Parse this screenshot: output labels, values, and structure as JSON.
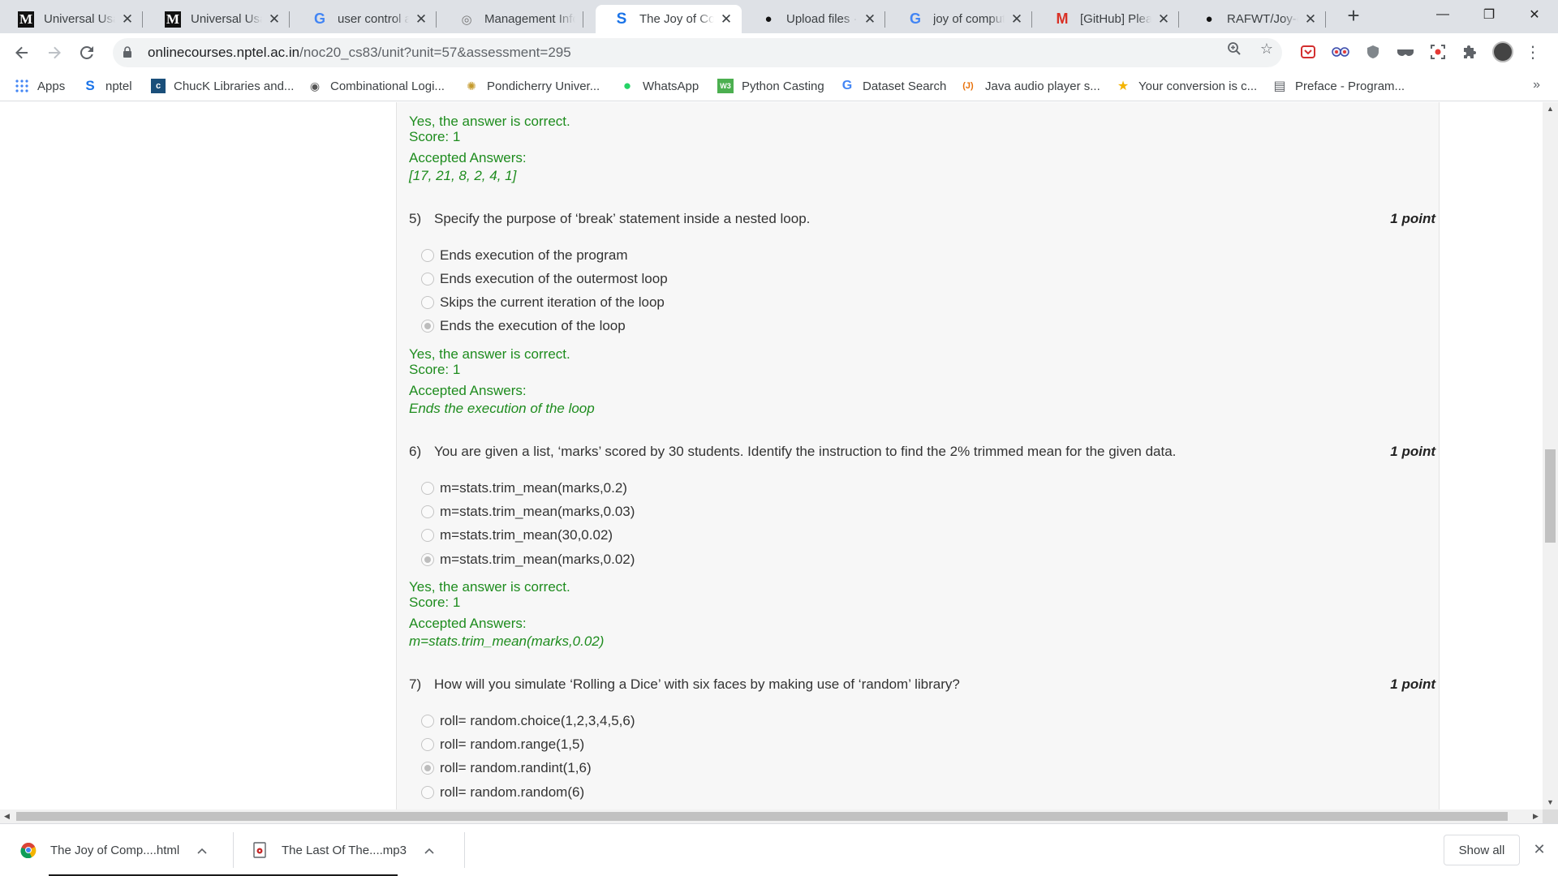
{
  "browser": {
    "tabs": [
      {
        "favicon": "medium-icon",
        "glyph": "M",
        "label": "Universal Usability in Practice",
        "active": false
      },
      {
        "favicon": "medium-icon",
        "glyph": "M",
        "label": "Universal Usability in Practice",
        "active": false
      },
      {
        "favicon": "google-icon",
        "glyph": "G",
        "label": "user control and freedom - Google Search",
        "active": false
      },
      {
        "favicon": "management-icon",
        "glyph": "◎",
        "label": "Management Information System",
        "active": false
      },
      {
        "favicon": "swayam-icon",
        "glyph": "S",
        "label": "The Joy of Computing using Python",
        "active": true
      },
      {
        "favicon": "github-icon",
        "glyph": "●",
        "label": "Upload files · RAFWT/Joy-of-Computing",
        "active": false
      },
      {
        "favicon": "google-icon",
        "glyph": "G",
        "label": "joy of computing using python - Google Search",
        "active": false
      },
      {
        "favicon": "gmail-icon",
        "glyph": "M",
        "label": "[GitHub] Please verify your device",
        "active": false
      },
      {
        "favicon": "github-icon",
        "glyph": "●",
        "label": "RAFWT/Joy-of-Computing",
        "active": false
      }
    ],
    "new_tab_glyph": "+",
    "window_controls": {
      "minimize": "—",
      "restore": "❐",
      "close": "✕"
    },
    "close_tab_glyph": "✕",
    "url": {
      "host": "onlinecourses.nptel.ac.in",
      "path": "/noc20_cs83/unit?unit=57&assessment=295"
    },
    "bookmarks": [
      {
        "icon": "apps-icon",
        "glyph": "⋮⋮",
        "label": "Apps",
        "color": "#4285f4"
      },
      {
        "icon": "nptel-icon",
        "glyph": "S",
        "label": "nptel",
        "color": "#1a73e8"
      },
      {
        "icon": "chuck-icon",
        "glyph": "Ⓒ",
        "label": "ChucK Libraries and...",
        "color": "#1a4f7a"
      },
      {
        "icon": "globe-icon",
        "glyph": "◉",
        "label": "Combinational Logi...",
        "color": "#555555"
      },
      {
        "icon": "pondicherry-icon",
        "glyph": "✺",
        "label": "Pondicherry Univer...",
        "color": "#c49a2c"
      },
      {
        "icon": "whatsapp-icon",
        "glyph": "●",
        "label": "WhatsApp",
        "color": "#25d366"
      },
      {
        "icon": "python-casting-icon",
        "glyph": "W3",
        "label": "Python Casting",
        "color": "#4caf50"
      },
      {
        "icon": "google-icon",
        "glyph": "G",
        "label": "Dataset Search",
        "color": "#4285f4"
      },
      {
        "icon": "java-icon",
        "glyph": "(J)",
        "label": "Java audio player s...",
        "color": "#e8710a"
      },
      {
        "icon": "conversion-icon",
        "glyph": "★",
        "label": "Your conversion is c...",
        "color": "#f4b400"
      },
      {
        "icon": "page-icon",
        "glyph": "▤",
        "label": "Preface - Program...",
        "color": "#5f6368"
      }
    ],
    "bookmarks_more": "»"
  },
  "quiz": {
    "prev_feedback": {
      "correct": "Yes, the answer is correct.",
      "score": "Score: 1",
      "accepted_label": "Accepted Answers:",
      "accepted_value": "[17, 21, 8, 2, 4, 1]"
    },
    "questions": [
      {
        "number": "5)",
        "text": "Specify the purpose of ‘break’ statement inside a nested loop.",
        "points": "1 point",
        "options": [
          {
            "label": "Ends execution of the program",
            "selected": false
          },
          {
            "label": "Ends execution of the outermost loop",
            "selected": false
          },
          {
            "label": "Skips the current iteration of the loop",
            "selected": false
          },
          {
            "label": "Ends the execution of the loop",
            "selected": true
          }
        ],
        "feedback": {
          "correct": "Yes, the answer is correct.",
          "score": "Score: 1",
          "accepted_label": "Accepted Answers:",
          "accepted_value": "Ends the execution of the loop"
        }
      },
      {
        "number": "6)",
        "text": "You are given a list, ‘marks’ scored by 30 students. Identify the instruction to find the 2% trimmed mean for the given data.",
        "points": "1 point",
        "options": [
          {
            "label": "m=stats.trim_mean(marks,0.2)",
            "selected": false
          },
          {
            "label": "m=stats.trim_mean(marks,0.03)",
            "selected": false
          },
          {
            "label": "m=stats.trim_mean(30,0.02)",
            "selected": false
          },
          {
            "label": "m=stats.trim_mean(marks,0.02)",
            "selected": true
          }
        ],
        "feedback": {
          "correct": "Yes, the answer is correct.",
          "score": "Score: 1",
          "accepted_label": "Accepted Answers:",
          "accepted_value": "m=stats.trim_mean(marks,0.02)"
        }
      },
      {
        "number": "7)",
        "text": "How will you simulate ‘Rolling a Dice’ with six faces by making use of ‘random’ library?",
        "points": "1 point",
        "options": [
          {
            "label": "roll= random.choice(1,2,3,4,5,6)",
            "selected": false
          },
          {
            "label": "roll= random.range(1,5)",
            "selected": false
          },
          {
            "label": "roll= random.randint(1,6)",
            "selected": true
          },
          {
            "label": "roll= random.random(6)",
            "selected": false
          }
        ]
      }
    ]
  },
  "downloads": {
    "items": [
      {
        "icon": "chrome-file-icon",
        "name": "The Joy of Comp....html",
        "progress": 1.0
      },
      {
        "icon": "audio-file-icon",
        "name": "The Last Of The....mp3",
        "progress": 1.0
      }
    ],
    "show_all": "Show all",
    "chevron": "^",
    "close_glyph": "✕"
  },
  "colors": {
    "correct_green": "#1e8c1e",
    "chrome_tabstrip": "#dee1e6",
    "content_bg": "#f7f7f7"
  }
}
